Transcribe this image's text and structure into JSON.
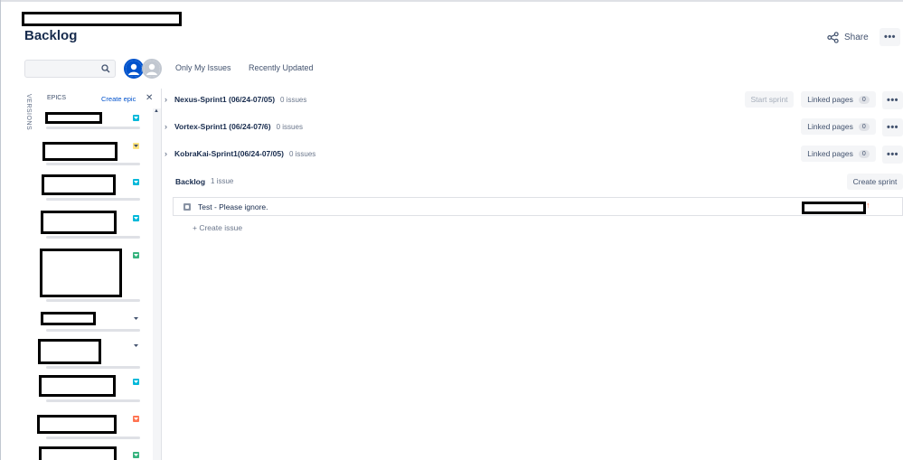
{
  "page": {
    "title": "Backlog"
  },
  "header": {
    "share_label": "Share",
    "more_icon": "•••"
  },
  "filters": {
    "search_placeholder": "",
    "quick_filters": [
      "Only My Issues",
      "Recently Updated"
    ]
  },
  "sidebar": {
    "versions_label": "VERSIONS",
    "epics_label": "EPICS",
    "create_epic_label": "Create epic",
    "close_icon": "✕",
    "epics": [
      {
        "color": "#00b8d9"
      },
      {
        "color": "#ffe380"
      },
      {
        "color": "#00b8d9"
      },
      {
        "color": "#00b8d9"
      },
      {
        "color": "#36b37e"
      },
      {
        "color": "#ffffff"
      },
      {
        "color": "#ffffff"
      },
      {
        "color": "#00b8d9"
      },
      {
        "color": "#ff7452"
      },
      {
        "color": "#36b37e"
      }
    ]
  },
  "sprints": [
    {
      "name": "Nexus-Sprint1 (06/24-07/05)",
      "count": "0 issues",
      "start_label": "Start sprint",
      "linked_label": "Linked pages",
      "linked_count": "0"
    },
    {
      "name": "Vortex-Sprint1 (06/24-07/6)",
      "count": "0 issues",
      "linked_label": "Linked pages",
      "linked_count": "0"
    },
    {
      "name": "KobraKai-Sprint1(06/24-07/05)",
      "count": "0 issues",
      "linked_label": "Linked pages",
      "linked_count": "0"
    }
  ],
  "backlog": {
    "title": "Backlog",
    "count": "1 issue",
    "create_sprint_label": "Create sprint",
    "issues": [
      {
        "summary": "Test - Please ignore."
      }
    ],
    "create_issue_label": "+ Create issue"
  },
  "colors": {
    "accent": "#0052cc",
    "priority_high": "#ff7452"
  }
}
